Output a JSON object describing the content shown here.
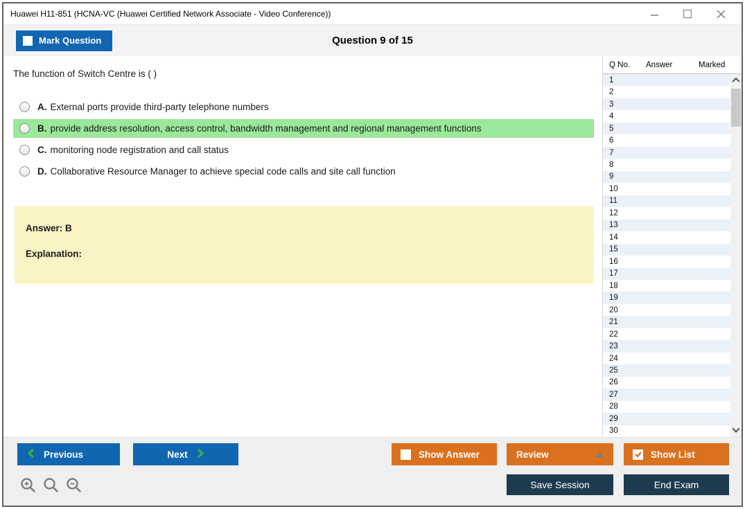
{
  "window": {
    "title": "Huawei H11-851 (HCNA-VC (Huawei Certified Network Associate - Video Conference))"
  },
  "header": {
    "mark_button": "Mark Question",
    "counter": "Question 9 of 15"
  },
  "question": {
    "text": "The function of Switch Centre is ( )",
    "options": [
      {
        "letter": "A.",
        "text": "External ports provide third-party telephone numbers",
        "selected": false
      },
      {
        "letter": "B.",
        "text": "provide address resolution, access control, bandwidth management and regional management functions",
        "selected": true
      },
      {
        "letter": "C.",
        "text": "monitoring node registration and call status",
        "selected": false
      },
      {
        "letter": "D.",
        "text": "Collaborative Resource Manager to achieve special code calls and site call function",
        "selected": false
      }
    ]
  },
  "answer_panel": {
    "answer": "Answer: B",
    "explanation": "Explanation:"
  },
  "question_list": {
    "columns": {
      "qno": "Q No.",
      "answer": "Answer",
      "marked": "Marked"
    },
    "rows": [
      {
        "no": "1",
        "answer": "",
        "marked": ""
      },
      {
        "no": "2",
        "answer": "",
        "marked": ""
      },
      {
        "no": "3",
        "answer": "",
        "marked": ""
      },
      {
        "no": "4",
        "answer": "",
        "marked": ""
      },
      {
        "no": "5",
        "answer": "",
        "marked": ""
      },
      {
        "no": "6",
        "answer": "",
        "marked": ""
      },
      {
        "no": "7",
        "answer": "",
        "marked": ""
      },
      {
        "no": "8",
        "answer": "",
        "marked": ""
      },
      {
        "no": "9",
        "answer": "",
        "marked": ""
      },
      {
        "no": "10",
        "answer": "",
        "marked": ""
      },
      {
        "no": "11",
        "answer": "",
        "marked": ""
      },
      {
        "no": "12",
        "answer": "",
        "marked": ""
      },
      {
        "no": "13",
        "answer": "",
        "marked": ""
      },
      {
        "no": "14",
        "answer": "",
        "marked": ""
      },
      {
        "no": "15",
        "answer": "",
        "marked": ""
      },
      {
        "no": "16",
        "answer": "",
        "marked": ""
      },
      {
        "no": "17",
        "answer": "",
        "marked": ""
      },
      {
        "no": "18",
        "answer": "",
        "marked": ""
      },
      {
        "no": "19",
        "answer": "",
        "marked": ""
      },
      {
        "no": "20",
        "answer": "",
        "marked": ""
      },
      {
        "no": "21",
        "answer": "",
        "marked": ""
      },
      {
        "no": "22",
        "answer": "",
        "marked": ""
      },
      {
        "no": "23",
        "answer": "",
        "marked": ""
      },
      {
        "no": "24",
        "answer": "",
        "marked": ""
      },
      {
        "no": "25",
        "answer": "",
        "marked": ""
      },
      {
        "no": "26",
        "answer": "",
        "marked": ""
      },
      {
        "no": "27",
        "answer": "",
        "marked": ""
      },
      {
        "no": "28",
        "answer": "",
        "marked": ""
      },
      {
        "no": "29",
        "answer": "",
        "marked": ""
      },
      {
        "no": "30",
        "answer": "",
        "marked": ""
      }
    ]
  },
  "footer": {
    "previous": "Previous",
    "next": "Next",
    "show_answer": "Show Answer",
    "review": "Review",
    "show_list": "Show List",
    "save_session": "Save Session",
    "end_exam": "End Exam"
  },
  "colors": {
    "blue": "#1166B2",
    "orange": "#D9711F",
    "navy": "#1D3A4E",
    "highlight_green": "#9BE89B",
    "answer_yellow": "#FAF3C3",
    "row_alt": "#EAF1F8",
    "chevron_green": "#3CB43C"
  }
}
